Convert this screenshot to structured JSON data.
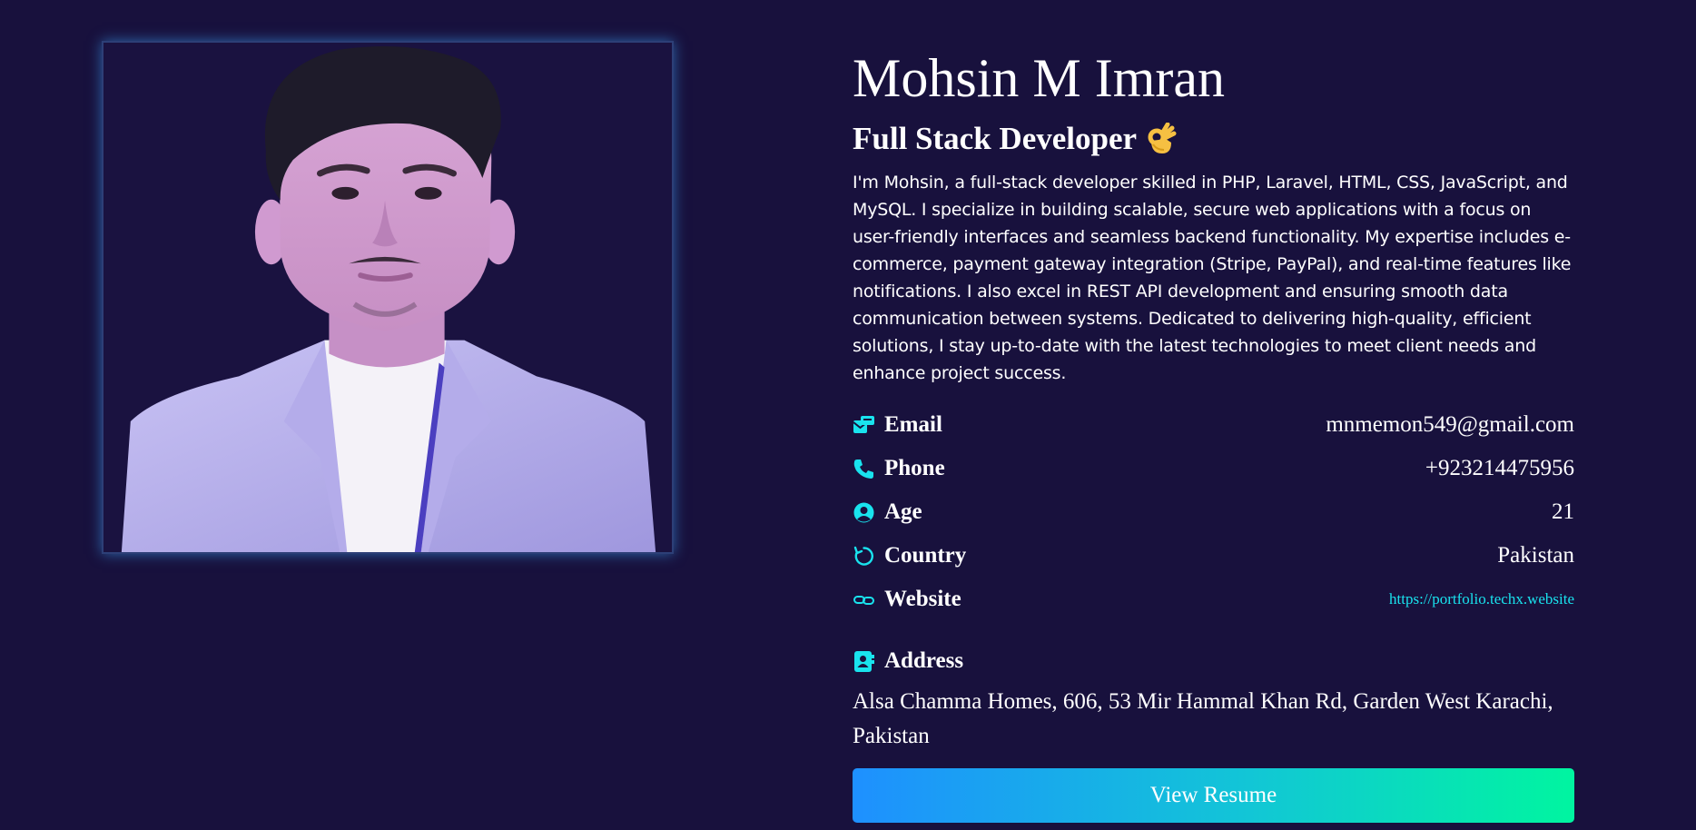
{
  "profile": {
    "name": "Mohsin M Imran",
    "role": "Full Stack Developer",
    "role_emoji": "ok-hand-icon",
    "bio": "I'm Mohsin, a full-stack developer skilled in PHP, Laravel, HTML, CSS, JavaScript, and MySQL. I specialize in building scalable, secure web applications with a focus on user-friendly interfaces and seamless backend functionality. My expertise includes e-commerce, payment gateway integration (Stripe, PayPal), and real-time features like notifications. I also excel in REST API development and ensuring smooth data communication between systems. Dedicated to delivering high-quality, efficient solutions, I stay up-to-date with the latest technologies to meet client needs and enhance project success."
  },
  "details": {
    "email_label": "Email",
    "email_value": "mnmemon549@gmail.com",
    "phone_label": "Phone",
    "phone_value": "+923214475956",
    "age_label": "Age",
    "age_value": "21",
    "country_label": "Country",
    "country_value": "Pakistan",
    "website_label": "Website",
    "website_value": "https://portfolio.techx.website"
  },
  "address": {
    "label": "Address",
    "value": "Alsa Chamma Homes, 606, 53 Mir Hammal Khan Rd, Garden West Karachi, Pakistan"
  },
  "actions": {
    "resume_label": "View Resume"
  },
  "colors": {
    "background": "#18113d",
    "accent": "#19e3ee",
    "button_gradient_start": "#1e90ff",
    "button_gradient_end": "#00f5a0"
  },
  "icons": {
    "email": "email-icon",
    "phone": "phone-icon",
    "age": "user-circle-icon",
    "country": "refresh-icon",
    "website": "link-icon",
    "address": "address-book-icon"
  }
}
